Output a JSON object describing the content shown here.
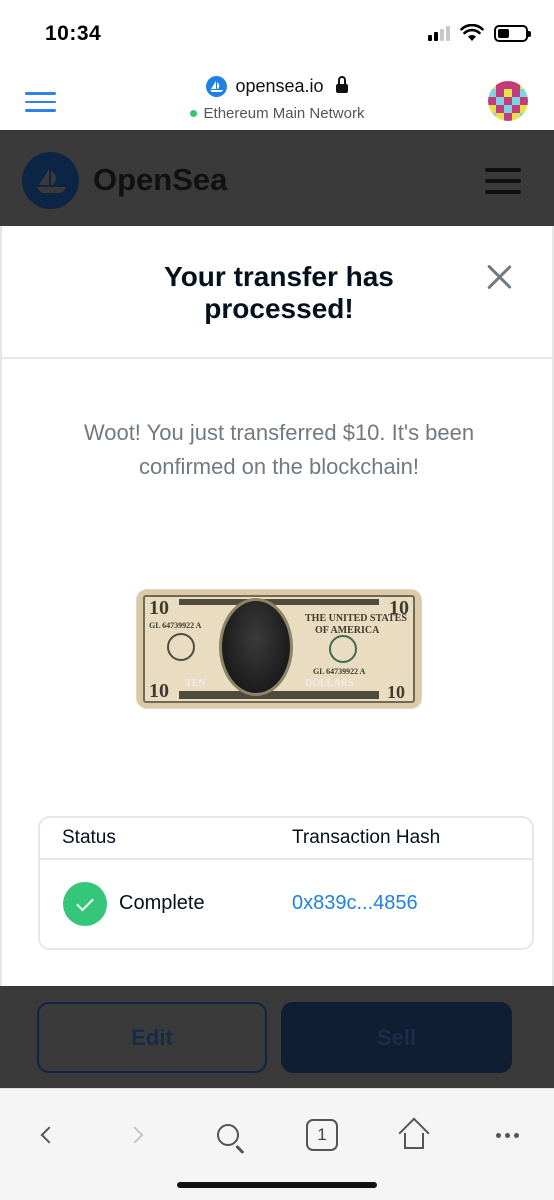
{
  "status_bar": {
    "time": "10:34"
  },
  "wallet_header": {
    "url": "opensea.io",
    "network": "Ethereum Main Network"
  },
  "site": {
    "brand": "OpenSea"
  },
  "modal": {
    "title": "Your transfer has processed!",
    "message": "Woot! You just transferred $10. It's been confirmed on the blockchain!",
    "table": {
      "headers": [
        "Status",
        "Transaction Hash"
      ],
      "row": {
        "status": "Complete",
        "hash": "0x839c...4856"
      }
    }
  },
  "footer": {
    "edit_label": "Edit",
    "sell_label": "Sell"
  },
  "toolbar": {
    "tab_count": "1"
  },
  "colors": {
    "accent_blue": "#2081e2",
    "success_green": "#34c77b",
    "overlay": "#3a3a3a",
    "network_dot": "#37c871"
  },
  "icons": [
    "signal-icon",
    "wifi-icon",
    "battery-icon",
    "menu-icon",
    "opensea-logo-icon",
    "lock-icon",
    "close-icon",
    "check-icon",
    "back-icon",
    "forward-icon",
    "search-icon",
    "tabs-icon",
    "home-icon",
    "more-icon"
  ]
}
